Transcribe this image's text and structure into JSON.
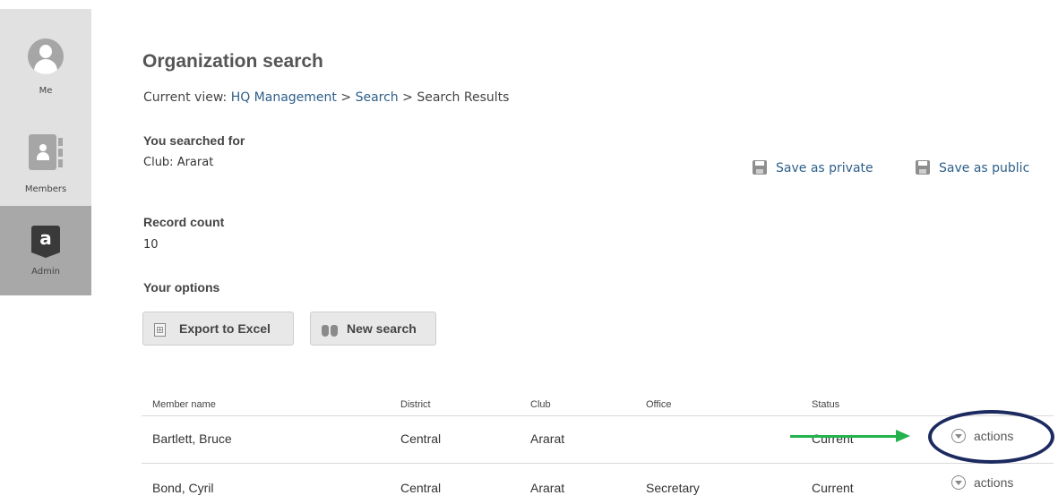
{
  "sidebar": {
    "items": [
      {
        "label": "Me",
        "icon": "user-icon"
      },
      {
        "label": "Members",
        "icon": "contacts-book-icon"
      },
      {
        "label": "Admin",
        "icon": "admin-badge-icon",
        "badge_letter": "a"
      }
    ]
  },
  "page": {
    "title": "Organization search",
    "breadcrumb": {
      "prefix": "Current view:",
      "links": [
        "HQ Management",
        "Search"
      ],
      "current": "Search Results",
      "separator": ">"
    }
  },
  "search": {
    "heading": "You searched for",
    "criteria": "Club: Ararat",
    "save_private": "Save as private",
    "save_public": "Save as public"
  },
  "record_count": {
    "heading": "Record count",
    "value": "10"
  },
  "options": {
    "heading": "Your options",
    "export_label": "Export to Excel",
    "new_search_label": "New search"
  },
  "table": {
    "columns": [
      "Member name",
      "District",
      "Club",
      "Office",
      "Status"
    ],
    "rows": [
      {
        "name": "Bartlett, Bruce",
        "district": "Central",
        "club": "Ararat",
        "office": "",
        "status": "Current",
        "action": "actions"
      },
      {
        "name": "Bond, Cyril",
        "district": "Central",
        "club": "Ararat",
        "office": "Secretary",
        "status": "Current",
        "action": "actions"
      }
    ]
  },
  "colors": {
    "link": "#2e5f8a",
    "annotation_arrow": "#23b24d",
    "annotation_circle": "#1c2a5f",
    "sidebar_bg": "#e1e1e1",
    "sidebar_active": "#a8a8a8"
  }
}
